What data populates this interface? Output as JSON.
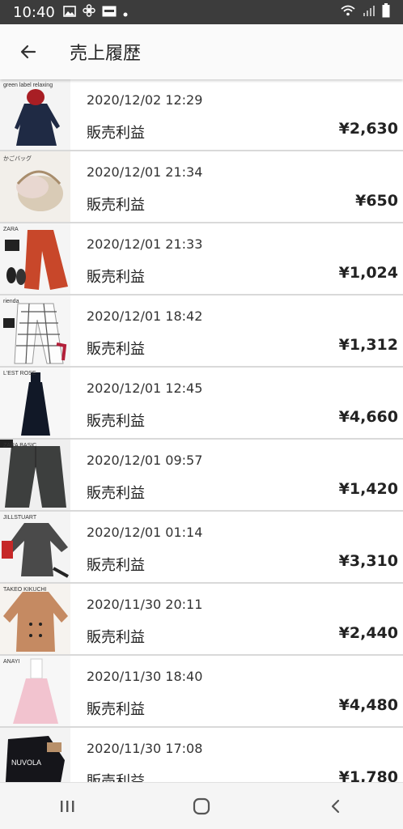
{
  "status_bar": {
    "time": "10:40"
  },
  "header": {
    "title": "売上履歴"
  },
  "items": [
    {
      "thumb_label": "green label relaxing",
      "date": "2020/12/02 12:29",
      "type": "販売利益",
      "amount": "¥2,630"
    },
    {
      "thumb_label": "かごバッグ",
      "date": "2020/12/01 21:34",
      "type": "販売利益",
      "amount": "¥650"
    },
    {
      "thumb_label": "ZARA",
      "date": "2020/12/01 21:33",
      "type": "販売利益",
      "amount": "¥1,024"
    },
    {
      "thumb_label": "rienda",
      "date": "2020/12/01 18:42",
      "type": "販売利益",
      "amount": "¥1,312"
    },
    {
      "thumb_label": "L'EST ROSE",
      "date": "2020/12/01 12:45",
      "type": "販売利益",
      "amount": "¥4,660"
    },
    {
      "thumb_label": "ZARA BASIC",
      "date": "2020/12/01 09:57",
      "type": "販売利益",
      "amount": "¥1,420"
    },
    {
      "thumb_label": "JILLSTUART",
      "date": "2020/12/01 01:14",
      "type": "販売利益",
      "amount": "¥3,310"
    },
    {
      "thumb_label": "TAKEO KIKUCHI",
      "date": "2020/11/30 20:11",
      "type": "販売利益",
      "amount": "¥2,440"
    },
    {
      "thumb_label": "ANAYI",
      "date": "2020/11/30 18:40",
      "type": "販売利益",
      "amount": "¥4,480"
    },
    {
      "thumb_label": "NUVOLA",
      "date": "2020/11/30 17:08",
      "type": "販売利益",
      "amount": "¥1,780"
    }
  ]
}
